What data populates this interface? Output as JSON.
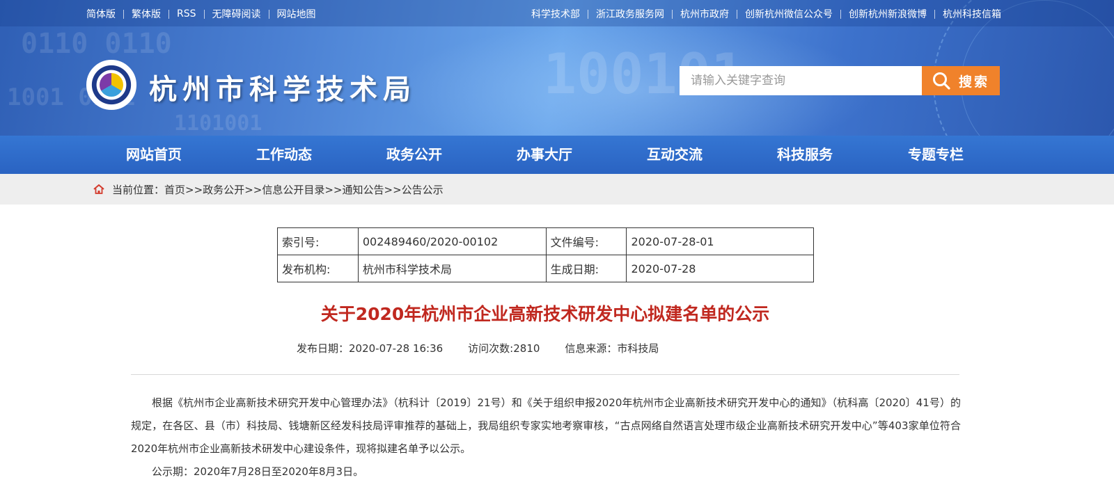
{
  "topbar": {
    "left_links": [
      "简体版",
      "繁体版",
      "RSS",
      "无障碍阅读",
      "网站地图"
    ],
    "right_links": [
      "科学技术部",
      "浙江政务服务网",
      "杭州市政府",
      "创新杭州微信公众号",
      "创新杭州新浪微博",
      "杭州科技信箱"
    ]
  },
  "header": {
    "site_title": "杭州市科学技术局",
    "search": {
      "placeholder": "请输入关键字查询",
      "button_label": "搜索"
    }
  },
  "nav": {
    "items": [
      "网站首页",
      "工作动态",
      "政务公开",
      "办事大厅",
      "互动交流",
      "科技服务",
      "专题专栏"
    ]
  },
  "breadcrumb": {
    "label": "当前位置：",
    "items": [
      "首页",
      "政务公开",
      "信息公开目录",
      "通知公告",
      "公告公示"
    ],
    "separator": ">>"
  },
  "meta_table": {
    "rows": [
      [
        "索引号:",
        "002489460/2020-00102",
        "文件编号:",
        "2020-07-28-01"
      ],
      [
        "发布机构:",
        "杭州市科学技术局",
        "生成日期:",
        "2020-07-28"
      ]
    ]
  },
  "article": {
    "title": "关于2020年杭州市企业高新技术研发中心拟建名单的公示",
    "publish_date": "发布日期：2020-07-28 16:36",
    "visits": "访问次数:2810",
    "source": "信息来源：市科技局",
    "paragraphs": [
      "根据《杭州市企业高新技术研究开发中心管理办法》（杭科计〔2019〕21号）和《关于组织申报2020年杭州市企业高新技术研究开发中心的通知》（杭科高〔2020〕41号）的规定，在各区、县（市）科技局、钱塘新区经发科技局评审推荐的基础上，我局组织专家实地考察审核，“古点网络自然语言处理市级企业高新技术研究开发中心”等403家单位符合2020年杭州市企业高新技术研发中心建设条件，现将拟建名单予以公示。",
      "公示期：2020年7月28日至2020年8月3日。"
    ]
  },
  "colors": {
    "nav_bg": "#2f6ac9",
    "search_button": "#f0822b",
    "title_red": "#c0281f",
    "breadcrumb_bg": "#eeeeee"
  }
}
